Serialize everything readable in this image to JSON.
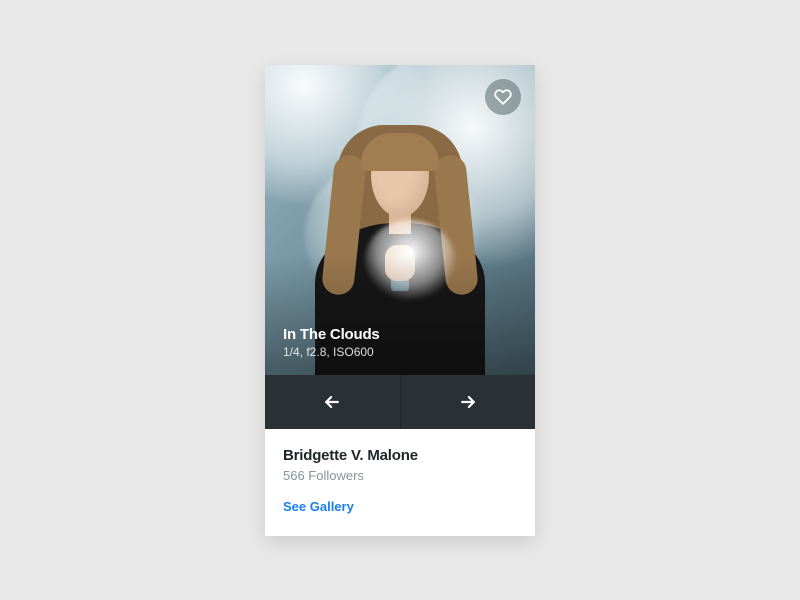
{
  "hero": {
    "title": "In The Clouds",
    "meta": "1/4, f2.8, ISO600"
  },
  "author": {
    "name": "Bridgette V. Malone",
    "followers": "566 Followers"
  },
  "actions": {
    "gallery_link": "See Gallery"
  }
}
